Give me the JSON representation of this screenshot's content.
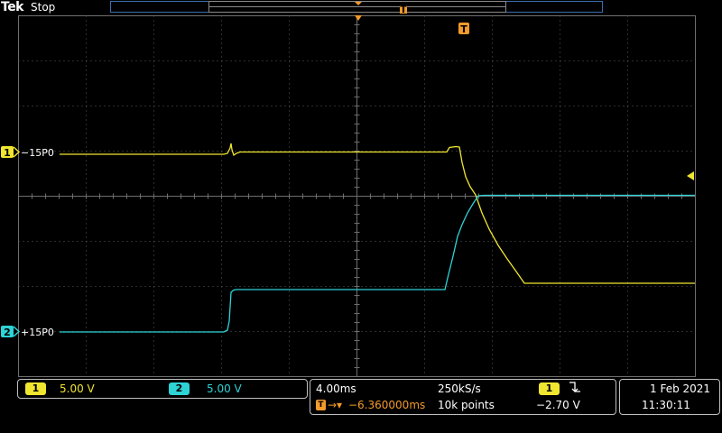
{
  "header": {
    "brand": "Tek",
    "status": "Stop"
  },
  "markers": {
    "trigger_badge": "T",
    "record_trigger_badge": "T"
  },
  "channels": [
    {
      "id": "1",
      "label": "−15P0",
      "color": "#f0e630",
      "scale": "5.00 V"
    },
    {
      "id": "2",
      "label": "+15P0",
      "color": "#2ed3d6",
      "scale": "5.00 V"
    }
  ],
  "horizontal": {
    "time_div": "4.00ms",
    "sample_rate": "250kS/s",
    "delay": "−6.360000ms",
    "record_length": "10k points"
  },
  "trigger": {
    "source": "1",
    "slope_icon": "falling-edge-icon",
    "level": "−2.70 V"
  },
  "datetime": {
    "date": "1 Feb 2021",
    "time": "11:30:11"
  },
  "colors": {
    "ch1": "#f0e630",
    "ch2": "#2ed3d6",
    "trigger": "#f39a2b",
    "grid": "#6e6e6e",
    "record_bar": "#3a6fb0"
  }
}
